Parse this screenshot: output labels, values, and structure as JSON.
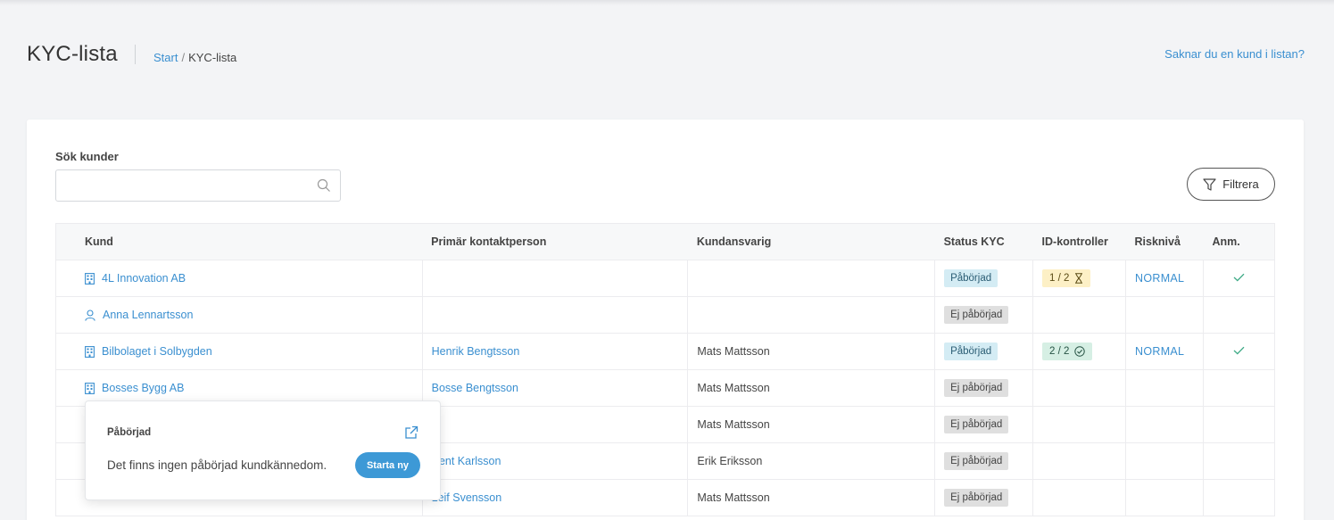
{
  "header": {
    "title": "KYC-lista",
    "breadcrumb": {
      "home": "Start",
      "separator": "/",
      "current": "KYC-lista"
    },
    "missing_customer_link": "Saknar du en kund i listan?"
  },
  "search": {
    "label": "Sök kunder",
    "value": "",
    "placeholder": ""
  },
  "filter_button": "Filtrera",
  "table": {
    "headers": {
      "customer": "Kund",
      "contact": "Primär kontaktperson",
      "responsible": "Kundansvarig",
      "status": "Status KYC",
      "id_checks": "ID-kontroller",
      "risk": "Risknivå",
      "note": "Anm."
    },
    "rows": [
      {
        "icon": "building-icon",
        "customer": "4L Innovation AB",
        "contact": "",
        "responsible": "",
        "status": "Påbörjad",
        "status_type": "started",
        "id_checks": "1 / 2",
        "id_state": "pending",
        "risk": "NORMAL",
        "note": true
      },
      {
        "icon": "person-icon",
        "customer": "Anna Lennartsson",
        "contact": "",
        "responsible": "",
        "status": "Ej påbörjad",
        "status_type": "notstarted",
        "id_checks": "",
        "id_state": "",
        "risk": "",
        "note": false
      },
      {
        "icon": "building-icon",
        "customer": "Bilbolaget i Solbygden",
        "contact": "Henrik Bengtsson",
        "responsible": "Mats Mattsson",
        "status": "Påbörjad",
        "status_type": "started",
        "id_checks": "2 / 2",
        "id_state": "done",
        "risk": "NORMAL",
        "note": true
      },
      {
        "icon": "building-icon",
        "customer": "Bosses Bygg AB",
        "contact": "Bosse Bengtsson",
        "responsible": "Mats Mattsson",
        "status": "Ej påbörjad",
        "status_type": "notstarted",
        "id_checks": "",
        "id_state": "",
        "risk": "",
        "note": false
      },
      {
        "icon": "",
        "customer": "",
        "contact": "",
        "responsible": "Mats Mattsson",
        "status": "Ej påbörjad",
        "status_type": "notstarted",
        "id_checks": "",
        "id_state": "",
        "risk": "",
        "note": false
      },
      {
        "icon": "",
        "customer": "",
        "contact": "Kent Karlsson",
        "responsible": "Erik Eriksson",
        "status": "Ej påbörjad",
        "status_type": "notstarted",
        "id_checks": "",
        "id_state": "",
        "risk": "",
        "note": false
      },
      {
        "icon": "",
        "customer": "",
        "contact": "Leif Svensson",
        "responsible": "Mats Mattsson",
        "status": "Ej påbörjad",
        "status_type": "notstarted",
        "id_checks": "",
        "id_state": "",
        "risk": "",
        "note": false
      }
    ]
  },
  "popover": {
    "title": "Påbörjad",
    "message": "Det finns ingen påbörjad kundkännedom.",
    "button": "Starta ny"
  },
  "colors": {
    "accent": "#3a8fd0",
    "button": "#3d99d6",
    "started_badge": "#d4ecf4",
    "pending_badge": "#fdf0c6",
    "done_badge": "#d6efe4"
  }
}
